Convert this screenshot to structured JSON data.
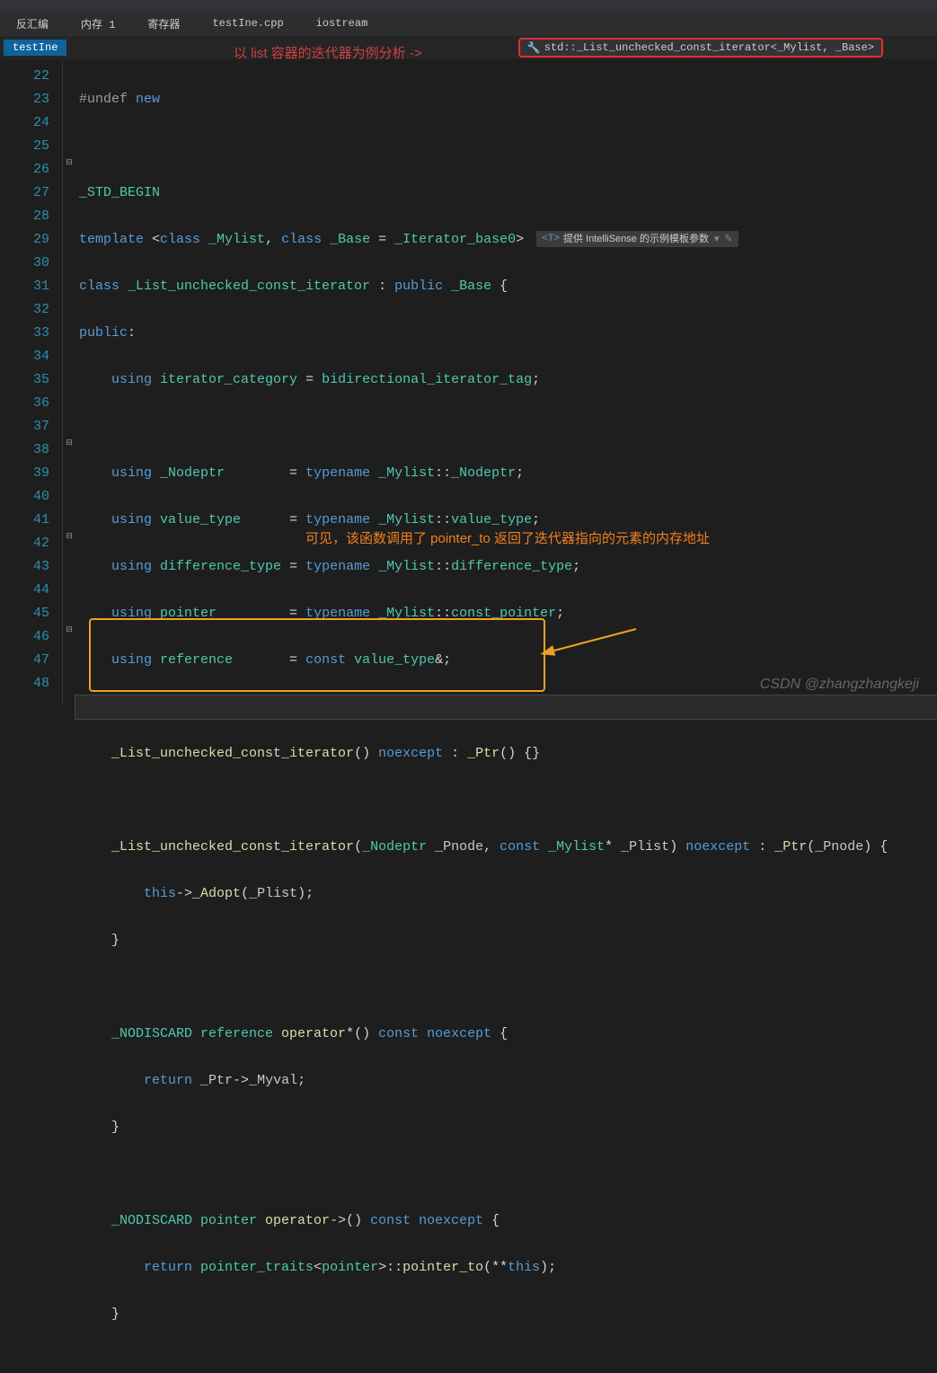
{
  "tabs": {
    "t1": "反汇编",
    "t2": "内存 1",
    "t3": "寄存器",
    "t4": "testIne.cpp",
    "t5": "iostream"
  },
  "nav": {
    "file": "testIne",
    "dropdown": "std::_List_unchecked_const_iterator<_Mylist, _Base>"
  },
  "annotations": {
    "top": "以 list 容器的迭代器为例分析 ->",
    "mid": "可见，该函数调用了 pointer_to 返回了迭代器指向的元素的内存地址"
  },
  "hint": {
    "prefix": "<T>",
    "text": "提供 IntelliSense 的示例模板参数"
  },
  "lines": [
    22,
    23,
    24,
    25,
    26,
    27,
    28,
    29,
    30,
    31,
    32,
    33,
    34,
    35,
    36,
    37,
    38,
    39,
    40,
    41,
    42,
    43,
    44,
    45,
    46,
    47,
    48
  ],
  "code": {
    "l22a": "#undef",
    "l22b": " new",
    "l24": "_STD_BEGIN",
    "l25a": "template",
    "l25b": " <",
    "l25c": "class",
    "l25d": " _Mylist",
    "l25e": ", ",
    "l25f": "class",
    "l25g": " _Base",
    "l25h": " = ",
    "l25i": "_Iterator_base0",
    "l25j": ">",
    "l26a": "class",
    "l26b": " _List_unchecked_const_iterator",
    "l26c": " : ",
    "l26d": "public",
    "l26e": " _Base",
    "l26f": " {",
    "l27a": "public",
    "l27b": ":",
    "l28a": "    ",
    "l28b": "using",
    "l28c": " iterator_category",
    "l28d": " = ",
    "l28e": "bidirectional_iterator_tag",
    "l28f": ";",
    "l30a": "    ",
    "l30b": "using",
    "l30c": " _Nodeptr",
    "l30d": "        = ",
    "l30e": "typename",
    "l30f": " _Mylist",
    "l30g": "::",
    "l30h": "_Nodeptr",
    "l30i": ";",
    "l31a": "    ",
    "l31b": "using",
    "l31c": " value_type",
    "l31d": "      = ",
    "l31e": "typename",
    "l31f": " _Mylist",
    "l31g": "::",
    "l31h": "value_type",
    "l31i": ";",
    "l32a": "    ",
    "l32b": "using",
    "l32c": " difference_type",
    "l32d": " = ",
    "l32e": "typename",
    "l32f": " _Mylist",
    "l32g": "::",
    "l32h": "difference_type",
    "l32i": ";",
    "l33a": "    ",
    "l33b": "using",
    "l33c": " pointer",
    "l33d": "         = ",
    "l33e": "typename",
    "l33f": " _Mylist",
    "l33g": "::",
    "l33h": "const_pointer",
    "l33i": ";",
    "l34a": "    ",
    "l34b": "using",
    "l34c": " reference",
    "l34d": "       = ",
    "l34e": "const",
    "l34f": " value_type",
    "l34g": "&;",
    "l36a": "    ",
    "l36b": "_List_unchecked_const_iterator",
    "l36c": "() ",
    "l36d": "noexcept",
    "l36e": " : ",
    "l36f": "_Ptr",
    "l36g": "() {}",
    "l38a": "    ",
    "l38b": "_List_unchecked_const_iterator",
    "l38c": "(",
    "l38d": "_Nodeptr",
    "l38e": " _Pnode",
    "l38f": ", ",
    "l38g": "const",
    "l38h": " _Mylist",
    "l38i": "* ",
    "l38j": "_Plist",
    "l38k": ") ",
    "l38l": "noexcept",
    "l38m": " : ",
    "l38n": "_Ptr",
    "l38o": "(",
    "l38p": "_Pnode",
    "l38q": ") {",
    "l39a": "        ",
    "l39b": "this",
    "l39c": "->",
    "l39d": "_Adopt",
    "l39e": "(",
    "l39f": "_Plist",
    "l39g": ");",
    "l40": "    }",
    "l42a": "    ",
    "l42b": "_NODISCARD",
    "l42c": " reference",
    "l42d": " operator",
    "l42e": "*() ",
    "l42f": "const",
    "l42g": " noexcept",
    "l42h": " {",
    "l43a": "        ",
    "l43b": "return",
    "l43c": " _Ptr",
    "l43d": "->",
    "l43e": "_Myval",
    "l43f": ";",
    "l44": "    }",
    "l46a": "    ",
    "l46b": "_NODISCARD",
    "l46c": " pointer",
    "l46d": " operator",
    "l46e": "->() ",
    "l46f": "const",
    "l46g": " noexcept",
    "l46h": " {",
    "l47a": "        ",
    "l47b": "return",
    "l47c": " pointer_traits",
    "l47d": "<",
    "l47e": "pointer",
    "l47f": ">::",
    "l47g": "pointer_to",
    "l47h": "(**",
    "l47i": "this",
    "l47j": ");",
    "l48": "    }"
  },
  "watermark": "CSDN @zhangzhangkeji"
}
